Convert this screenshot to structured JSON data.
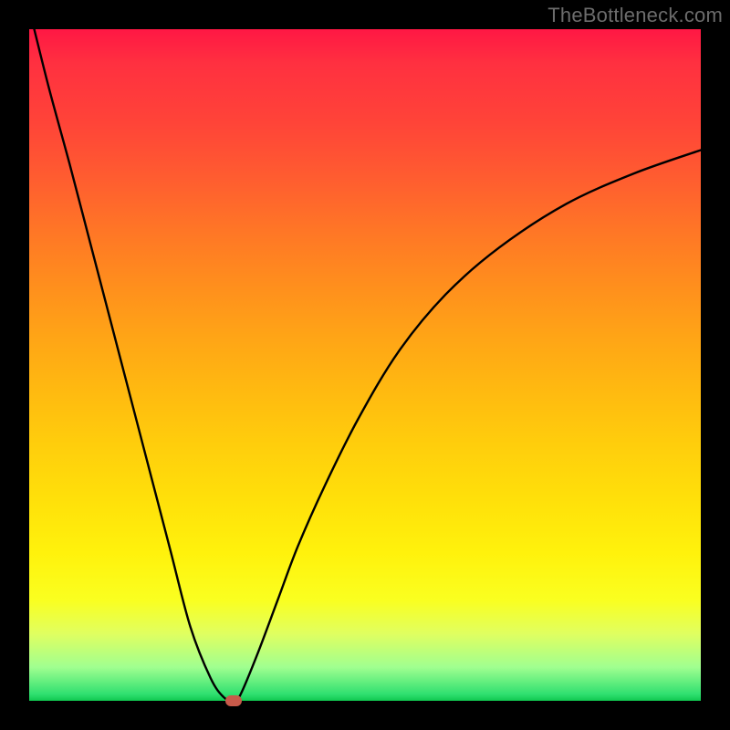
{
  "attribution": "TheBottleneck.com",
  "chart_data": {
    "type": "line",
    "title": "",
    "xlabel": "",
    "ylabel": "",
    "xlim": [
      0,
      100
    ],
    "ylim": [
      0,
      100
    ],
    "series": [
      {
        "name": "curve",
        "x": [
          0.5,
          3,
          6,
          9,
          12,
          15,
          18,
          21,
          24,
          27,
          29,
          30.5,
          31.5,
          34,
          37,
          40,
          44,
          49,
          55,
          62,
          70,
          80,
          90,
          100
        ],
        "values": [
          101,
          91,
          80,
          68.5,
          57,
          45.5,
          34,
          22.5,
          11,
          3.4,
          0.5,
          0,
          1,
          7,
          15,
          23,
          32,
          42,
          52,
          60.5,
          67.5,
          74,
          78.5,
          82
        ]
      }
    ],
    "marker": {
      "x": 30.5,
      "y": 0,
      "color": "#c85a4a"
    }
  }
}
